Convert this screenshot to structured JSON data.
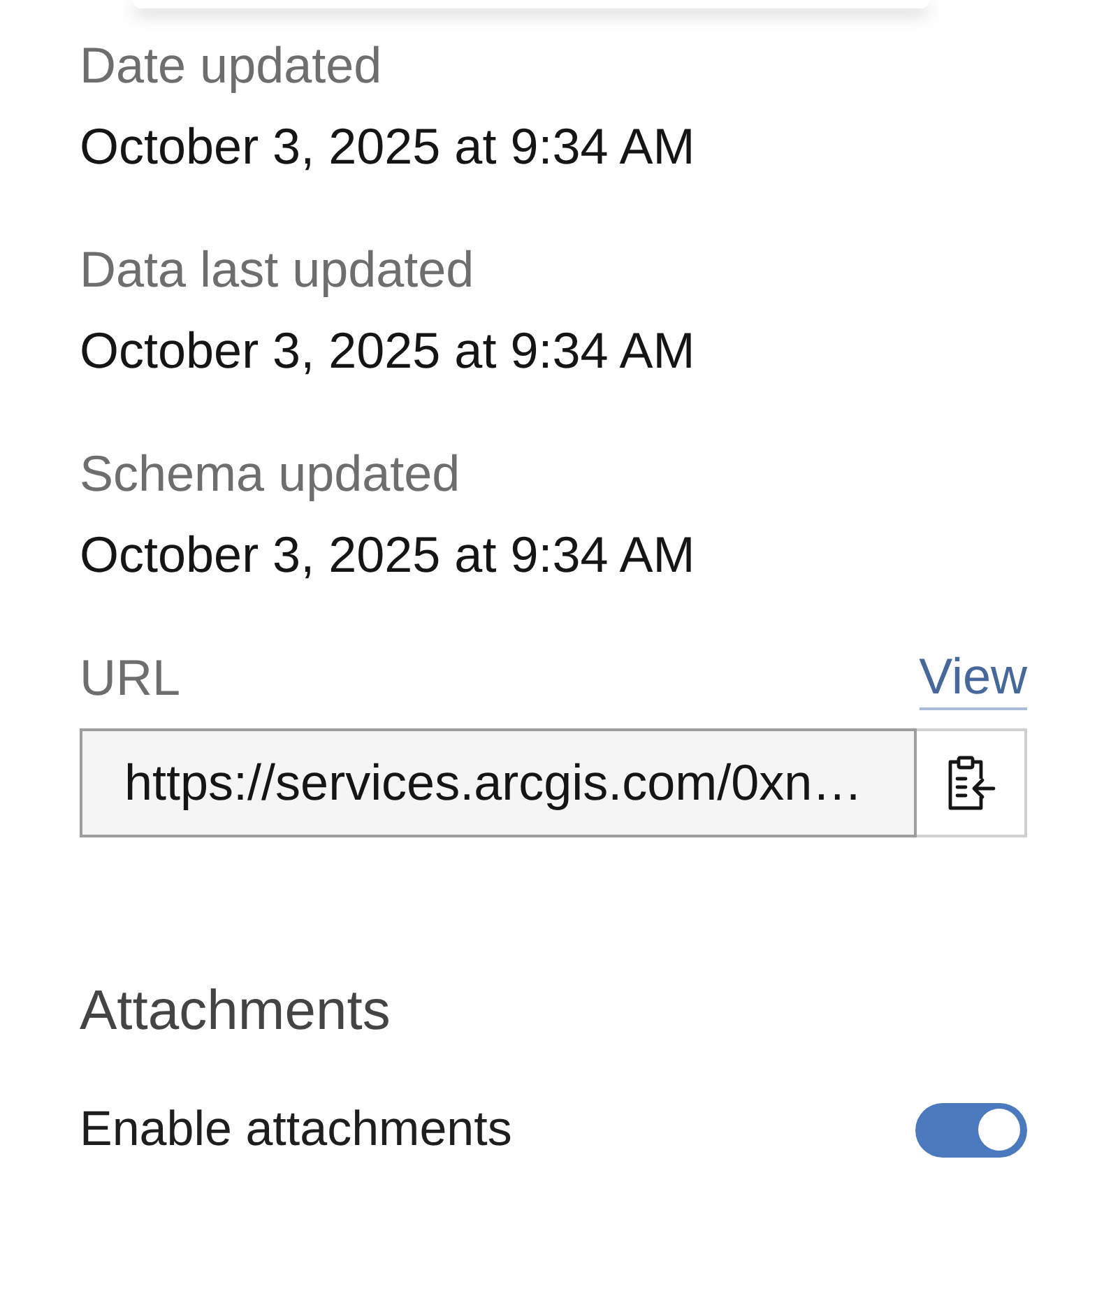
{
  "details": [
    {
      "label": "Date updated",
      "value": "October 3, 2025 at 9:34 AM"
    },
    {
      "label": "Data last updated",
      "value": "October 3, 2025 at 9:34 AM"
    },
    {
      "label": "Schema updated",
      "value": "October 3, 2025 at 9:34 AM"
    }
  ],
  "url": {
    "label": "URL",
    "link": "View",
    "value": "https://services.arcgis.com/0xn…"
  },
  "attachments": {
    "heading": "Attachments",
    "settings": [
      {
        "kind": "toggle",
        "label": "Enable attachments",
        "on": true
      }
    ]
  }
}
